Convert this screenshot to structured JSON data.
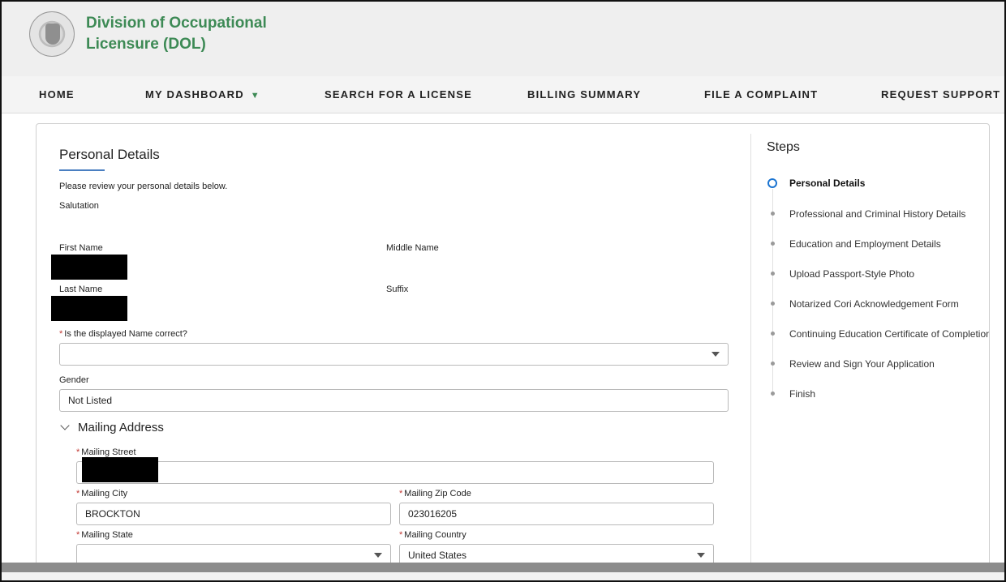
{
  "header": {
    "org_name": "Division of Occupational Licensure (DOL)"
  },
  "nav": {
    "home": "HOME",
    "dashboard": "MY DASHBOARD",
    "dashboard_caret": "▼",
    "search": "SEARCH FOR A LICENSE",
    "billing": "BILLING SUMMARY",
    "complaint": "FILE A COMPLAINT",
    "support": "REQUEST SUPPORT"
  },
  "form": {
    "title": "Personal Details",
    "intro": "Please review your personal details below.",
    "salutation_label": "Salutation",
    "first_name_label": "First Name",
    "middle_name_label": "Middle Name",
    "last_name_label": "Last Name",
    "suffix_label": "Suffix",
    "name_correct_label": "Is the displayed Name correct?",
    "name_correct_value": "",
    "gender_label": "Gender",
    "gender_value": "Not Listed",
    "mailing_section": "Mailing Address",
    "street_label": "Mailing Street",
    "city_label": "Mailing City",
    "city_value": "BROCKTON",
    "zip_label": "Mailing Zip Code",
    "zip_value": "023016205",
    "state_label": "Mailing State",
    "state_value": "",
    "country_label": "Mailing Country",
    "country_value": "United States",
    "required_mark": "*"
  },
  "steps": {
    "title": "Steps",
    "items": [
      {
        "label": "Personal Details",
        "active": true
      },
      {
        "label": "Professional and Criminal History Details",
        "active": false
      },
      {
        "label": "Education and Employment Details",
        "active": false
      },
      {
        "label": "Upload Passport-Style Photo",
        "active": false
      },
      {
        "label": "Notarized Cori Acknowledgement Form",
        "active": false
      },
      {
        "label": "Continuing Education Certificate of Completion",
        "active": false
      },
      {
        "label": "Review and Sign Your Application",
        "active": false
      },
      {
        "label": "Finish",
        "active": false
      }
    ]
  },
  "colors": {
    "brand_green": "#3d8a55",
    "active_step_blue": "#1b74d1",
    "required_red": "#c23934"
  }
}
